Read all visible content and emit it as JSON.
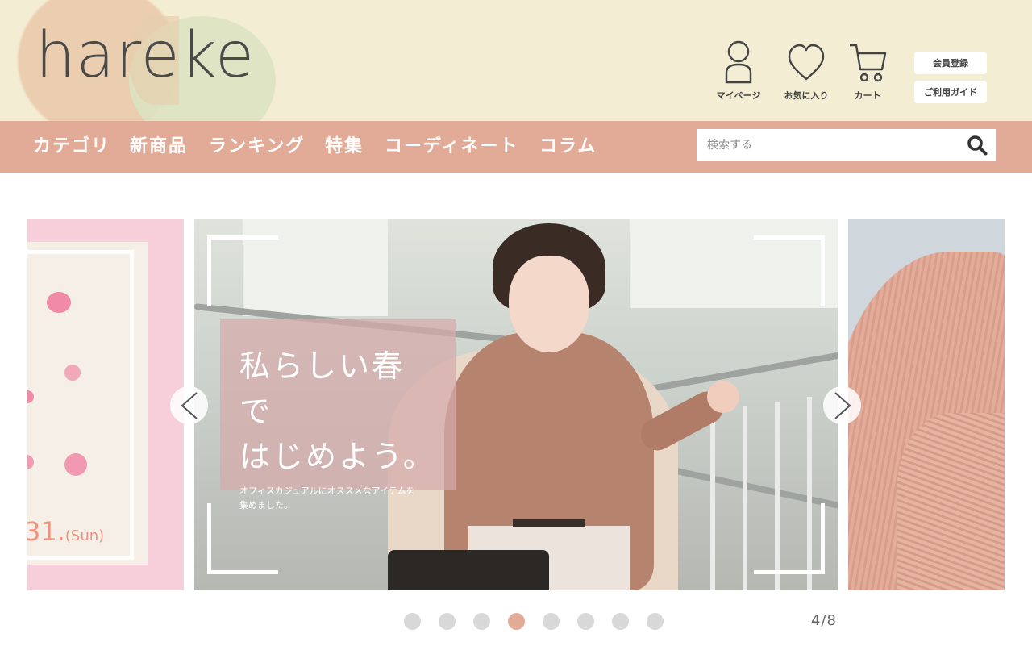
{
  "brand": {
    "logo_text": "hareke",
    "header_bg": "#f3edd3",
    "accent": "#e2ab98"
  },
  "header": {
    "icons": [
      {
        "name": "user-icon",
        "label": "マイページ"
      },
      {
        "name": "heart-icon",
        "label": "お気に入り"
      },
      {
        "name": "cart-icon",
        "label": "カート"
      }
    ],
    "register_label": "会員登録",
    "guide_label": "ご利用ガイド"
  },
  "nav": {
    "items": [
      "カテゴリ",
      "新商品",
      "ランキング",
      "特集",
      "コーディネート",
      "コラム"
    ]
  },
  "search": {
    "placeholder": "検索する",
    "value": "",
    "icon": "search-icon"
  },
  "carousel": {
    "left_slide": {
      "date_text": "31.",
      "day_text": "(Sun)"
    },
    "main_slide": {
      "headline": "私らしい春で\nはじめよう。",
      "subtext": "オフィスカジュアルにオススメなアイテムを\n集めました。"
    },
    "prev_icon": "chevron-left-icon",
    "next_icon": "chevron-right-icon",
    "current": 4,
    "total": 8,
    "counter_text": "4/8"
  }
}
